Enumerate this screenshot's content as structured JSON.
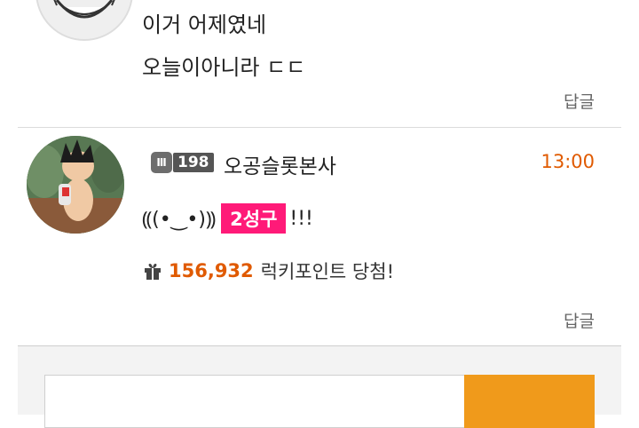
{
  "previous_comment": {
    "line1": "이거 어제였네",
    "line2": "오늘이아니라 ㄷㄷ",
    "reply_label": "답글"
  },
  "comment": {
    "level": "198",
    "username": "오공슬롯본사",
    "time": "13:00",
    "emoticon": "⸨(•‿•)⸩",
    "highlight": "2성구",
    "suffix": "!!!",
    "points": "156,932",
    "points_text": "럭키포인트 당첨!",
    "reply_label": "답글"
  },
  "colors": {
    "accent_orange": "#e05a00",
    "highlight_pink": "#ff1a78",
    "submit_button": "#f09a1b"
  }
}
